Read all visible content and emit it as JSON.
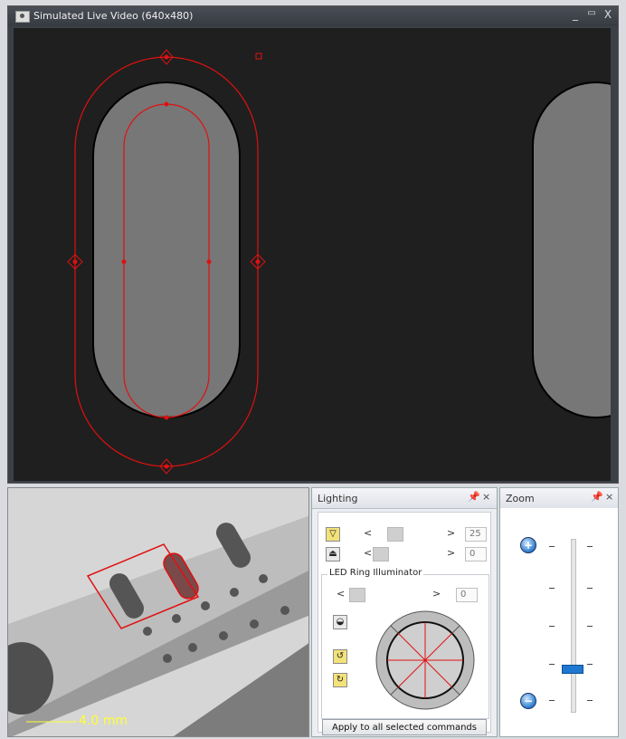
{
  "video_window": {
    "title": "Simulated Live Video (640x480)",
    "controls": {
      "minimize": "_",
      "maximize": "▭",
      "close": "X"
    }
  },
  "part_view": {
    "scale_label": "4.0 mm"
  },
  "lighting": {
    "title": "Lighting",
    "pin": "ꟷ",
    "close": "×",
    "rows": [
      {
        "icon": "top-light-icon",
        "value": "25"
      },
      {
        "icon": "bottom-light-icon",
        "value": "0"
      }
    ],
    "led_group_label": "LED Ring Illuminator",
    "led_value": "0",
    "arrow_left": "<",
    "arrow_right": ">",
    "apply_button": "Apply to all selected commands"
  },
  "zoom": {
    "title": "Zoom",
    "pin": "ꟷ",
    "close": "×",
    "zoom_in": "+",
    "zoom_out": "−",
    "level": 0.25
  },
  "colors": {
    "overlay_red": "#e01010",
    "zoom_thumb": "#1e78d0",
    "scale_yellow": "#ffff33"
  }
}
